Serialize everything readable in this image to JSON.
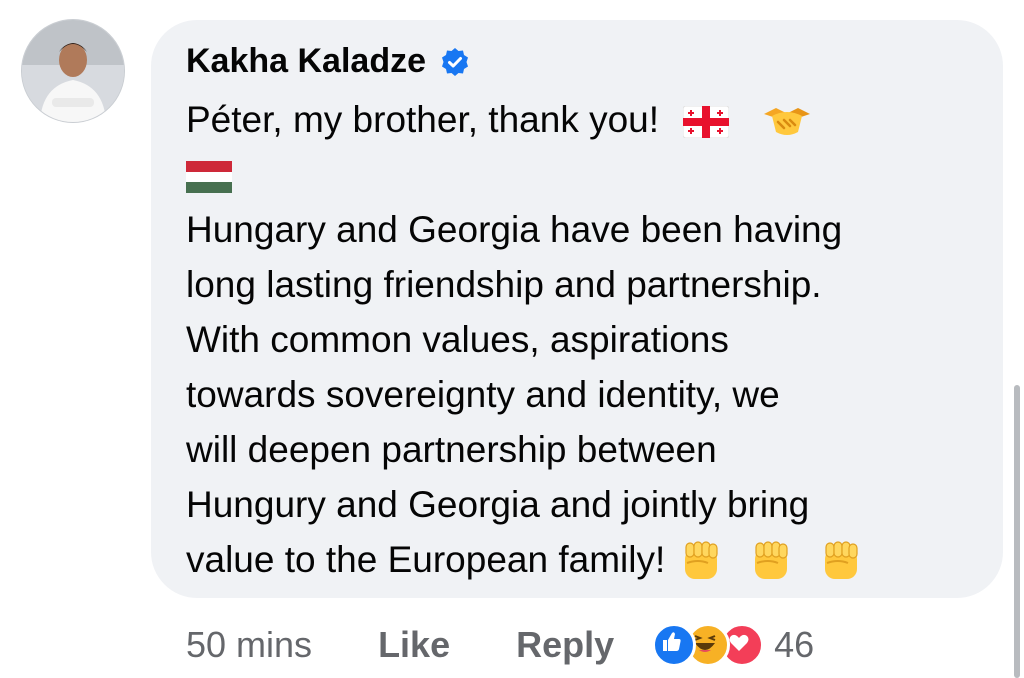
{
  "comment": {
    "author": "Kakha Kaladze",
    "lines": [
      "Péter, my brother, thank you!",
      "",
      "Hungary and Georgia have been having",
      "long lasting friendship and partnership.",
      "With common values, aspirations",
      "towards sovereignty and identity, we",
      "will deepen partnership between",
      "Hungury and Georgia and jointly bring",
      "value to the European family!"
    ],
    "emojis": [
      "georgia-flag",
      "handshake",
      "hungary-flag",
      "raised-fist",
      "raised-fist",
      "raised-fist"
    ]
  },
  "meta": {
    "time": "50 mins",
    "like_label": "Like",
    "reply_label": "Reply",
    "reaction_count": "46",
    "reactions": [
      "like",
      "haha",
      "love"
    ]
  },
  "colors": {
    "bubble": "#f0f2f5",
    "text": "#050505",
    "meta": "#65676b",
    "verified": "#1877f2"
  }
}
